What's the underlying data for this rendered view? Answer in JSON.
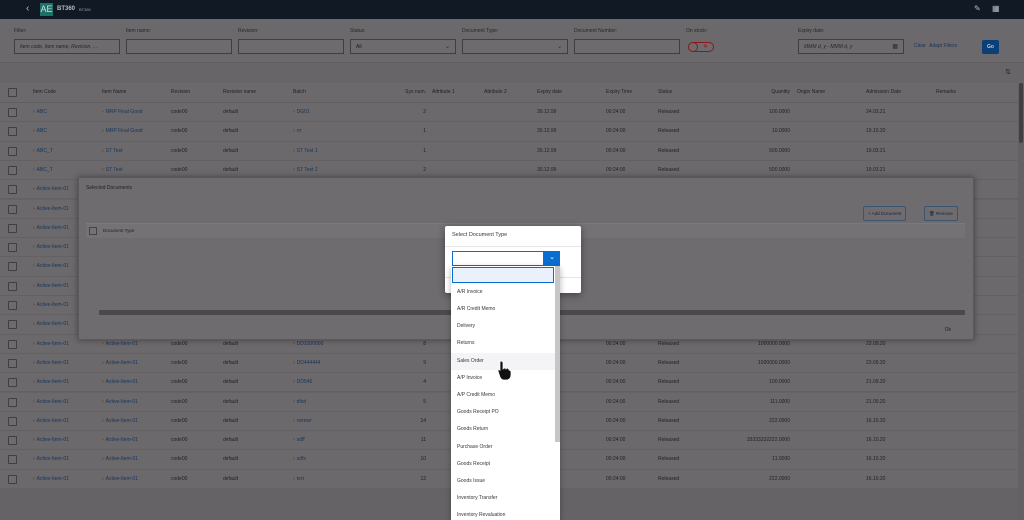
{
  "shell": {
    "logo": "AE",
    "title": "BT360",
    "subtitle": "BT360"
  },
  "filters": {
    "filter_label": "Filter:",
    "filter_placeholder": "Item code, Item name, Revision, ...",
    "item_name_label": "Item name:",
    "revision_label": "Revision:",
    "status_label": "Status:",
    "status_value": "All",
    "doc_type_label": "Document Type:",
    "doc_number_label": "Document Number:",
    "on_stock_label": "On stock:",
    "on_stock": false,
    "expiry_label": "Expiry date:",
    "expiry_placeholder": "MMM d, y - MMM d, y",
    "clear": "Clear",
    "adapt": "Adapt Filters",
    "go": "Go"
  },
  "toolbar": {
    "selected_docs": "Selected Documents",
    "count": "0"
  },
  "columns": {
    "item_code": "Item Code",
    "item_name": "Item Name",
    "revision": "Revision",
    "revision_name": "Revision name",
    "batch": "Batch",
    "sys_num": "Sys num.",
    "attr1": "Attribute 1",
    "attr2": "Attribute 2",
    "expiry_date": "Expiry date",
    "expiry_time": "Expiry Time",
    "status": "Status",
    "quantity": "Quantity",
    "origin": "Origin Name",
    "admission": "Admission Date",
    "remarks": "Remarks"
  },
  "rows": [
    {
      "item_code": "ABC",
      "item_name": "MRP Final Good",
      "revision": "code00",
      "revision_name": "default",
      "batch": "DG01",
      "sys_num": "2",
      "expiry_date": "30.12.99",
      "expiry_time": "00:24:00",
      "status": "Released",
      "quantity": "100.0000",
      "admission": "24.03.21"
    },
    {
      "item_code": "ABC",
      "item_name": "MRP Final Good",
      "revision": "code00",
      "revision_name": "default",
      "batch": "rrr",
      "sys_num": "1",
      "expiry_date": "30.12.99",
      "expiry_time": "00:24:00",
      "status": "Released",
      "quantity": "10.0000",
      "admission": "19.10.20"
    },
    {
      "item_code": "ABC_T",
      "item_name": "ST Test",
      "revision": "code00",
      "revision_name": "default",
      "batch": "ST Test 1",
      "sys_num": "1",
      "expiry_date": "30.12.99",
      "expiry_time": "00:24:00",
      "status": "Released",
      "quantity": "500.0000",
      "admission": "19.03.21"
    },
    {
      "item_code": "ABC_T",
      "item_name": "ST Test",
      "revision": "code00",
      "revision_name": "default",
      "batch": "ST Test 2",
      "sys_num": "2",
      "expiry_date": "30.12.99",
      "expiry_time": "00:24:00",
      "status": "Released",
      "quantity": "500.0000",
      "admission": "19.03.21"
    },
    {
      "item_code": "Active-Item-01"
    },
    {
      "item_code": "Active-Item-01"
    },
    {
      "item_code": "Active-Item-01"
    },
    {
      "item_code": "Active-Item-01"
    },
    {
      "item_code": "Active-Item-01"
    },
    {
      "item_code": "Active-Item-01"
    },
    {
      "item_code": "Active-Item-01"
    },
    {
      "item_code": "Active-Item-01"
    },
    {
      "item_code": "Active-Item-01",
      "item_name": "Active-Item-01",
      "revision": "code00",
      "revision_name": "default",
      "batch": "DD1000000",
      "sys_num": "8",
      "expiry_time": "00:24:00",
      "status": "Released",
      "quantity": "1000000.0000",
      "admission": "23.09.20"
    },
    {
      "item_code": "Active-Item-01",
      "item_name": "Active-Item-01",
      "revision": "code00",
      "revision_name": "default",
      "batch": "DD444444",
      "sys_num": "9",
      "expiry_time": "00:24:00",
      "status": "Released",
      "quantity": "1000000.0000",
      "admission": "23.09.20"
    },
    {
      "item_code": "Active-Item-01",
      "item_name": "Active-Item-01",
      "revision": "code00",
      "revision_name": "default",
      "batch": "DD546",
      "sys_num": "4",
      "expiry_time": "00:24:00",
      "status": "Released",
      "quantity": "100.0000",
      "admission": "21.09.20"
    },
    {
      "item_code": "Active-Item-01",
      "item_name": "Active-Item-01",
      "revision": "code00",
      "revision_name": "default",
      "batch": "dfsd",
      "sys_num": "5",
      "expiry_time": "00:24:00",
      "status": "Released",
      "quantity": "111.0000",
      "admission": "21.09.20"
    },
    {
      "item_code": "Active-Item-01",
      "item_name": "Active-Item-01",
      "revision": "code00",
      "revision_name": "default",
      "batch": "rwrewr",
      "sys_num": "14",
      "expiry_time": "00:24:00",
      "status": "Released",
      "quantity": "222.0000",
      "admission": "16.10.20"
    },
    {
      "item_code": "Active-Item-01",
      "item_name": "Active-Item-01",
      "revision": "code00",
      "revision_name": "default",
      "batch": "sdff",
      "sys_num": "11",
      "expiry_time": "00:24:00",
      "status": "Released",
      "quantity": "33333332222.0000",
      "admission": "16.10.20"
    },
    {
      "item_code": "Active-Item-01",
      "item_name": "Active-Item-01",
      "revision": "code00",
      "revision_name": "default",
      "batch": "sdfs",
      "sys_num": "10",
      "expiry_time": "00:24:00",
      "status": "Released",
      "quantity": "11.0000",
      "admission": "16.10.20"
    },
    {
      "item_code": "Active-Item-01",
      "item_name": "Active-Item-01",
      "revision": "code00",
      "revision_name": "default",
      "batch": "tert",
      "sys_num": "12",
      "expiry_time": "00:24:00",
      "status": "Released",
      "quantity": "222.0000",
      "admission": "16.10.20"
    }
  ],
  "selected_dialog": {
    "title": "Selected Documents",
    "column": "Document Type",
    "add": "Add Document",
    "remove": "Remove",
    "ok": "Ok"
  },
  "select_dialog": {
    "title": "Select Document Type",
    "value": ""
  },
  "dropdown_options": [
    "",
    "A/R Invoice",
    "A/R Credit Memo",
    "Delivery",
    "Returns",
    "Sales Order",
    "A/P Invoice",
    "A/P Credit Memo",
    "Goods Receipt PO",
    "Goods Return",
    "Purchase Order",
    "Goods Receipt",
    "Goods Issue",
    "Inventory Transfer",
    "Inventory Revaluation"
  ],
  "hovered_option": "Sales Order"
}
